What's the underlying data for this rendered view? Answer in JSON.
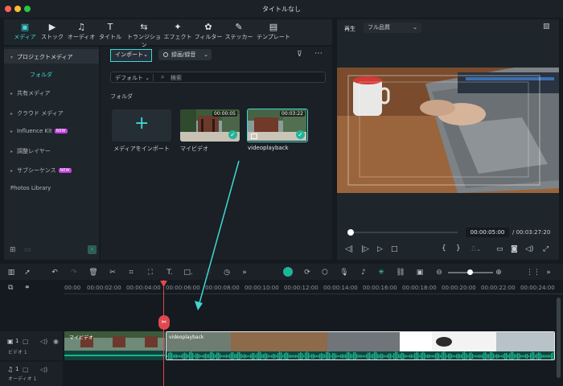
{
  "window": {
    "title": "タイトルなし"
  },
  "toolbar": {
    "items": [
      {
        "label": "メディア",
        "icon": "media-icon"
      },
      {
        "label": "ストック",
        "icon": "stock-icon"
      },
      {
        "label": "オーディオ",
        "icon": "audio-icon"
      },
      {
        "label": "タイトル",
        "icon": "title-icon"
      },
      {
        "label": "トランジション",
        "icon": "transition-icon"
      },
      {
        "label": "エフェクト",
        "icon": "effect-icon"
      },
      {
        "label": "フィルター",
        "icon": "filter-icon"
      },
      {
        "label": "ステッカー",
        "icon": "sticker-icon"
      },
      {
        "label": "テンプレート",
        "icon": "template-icon"
      }
    ]
  },
  "sidebar": {
    "items": [
      {
        "label": "プロジェクトメディア"
      },
      {
        "label": "フォルダ"
      },
      {
        "label": "共有メディア"
      },
      {
        "label": "クラウド メディア"
      },
      {
        "label": "Influence Kit",
        "badge": "NEW"
      },
      {
        "label": "調整レイヤー"
      },
      {
        "label": "サブシーケンス",
        "badge": "NEW"
      },
      {
        "label": "Photos Library"
      }
    ]
  },
  "media": {
    "import_label": "インポート",
    "record_label": "録画/録音",
    "sort_label": "デフォルト",
    "search_placeholder": "検索",
    "folder_heading": "フォルダ",
    "import_tile_label": "メディアをインポート",
    "clips": [
      {
        "name": "マイビデオ",
        "duration": "00:00:05"
      },
      {
        "name": "videoplayback",
        "duration": "00:03:22"
      }
    ]
  },
  "preview": {
    "play_label": "再生",
    "quality": "フル品質",
    "current_time": "00:00:05:00",
    "total_time": "/ 00:03:27:20",
    "progress": 0.024
  },
  "timeline": {
    "ruler": [
      "00:00",
      "00:00:02:00",
      "00:00:04:00",
      "00:00:06:00",
      "00:00:08:00",
      "00:00:10:00",
      "00:00:12:00",
      "00:00:14:00",
      "00:00:16:00",
      "00:00:18:00",
      "00:00:20:00",
      "00:00:22:00",
      "00:00:24:00"
    ],
    "tracks": {
      "video_label": "ビデオ 1",
      "audio_label": "オーディオ 1",
      "video_num": "1",
      "audio_num": "1"
    },
    "clips": [
      {
        "name": "マイビデオ"
      },
      {
        "name": "videoplayback"
      }
    ]
  },
  "colors": {
    "accent": "#3fd7d4",
    "playhead": "#e0484e",
    "badge": "#c43ee0",
    "audio_wave": "#1fae8e"
  }
}
